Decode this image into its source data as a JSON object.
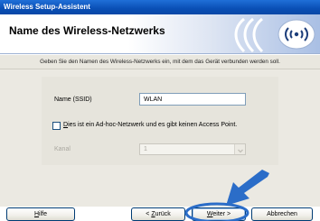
{
  "window": {
    "title": "Wireless Setup-Assistent"
  },
  "header": {
    "title": "Name des Wireless-Netzwerks"
  },
  "instruction": "Geben Sie den Namen des Wireless-Netzwerks ein, mit dem das Gerät verbunden werden soll.",
  "form": {
    "ssid_label": "Name (SSID)",
    "ssid_value": "WLAN",
    "adhoc_checked": false,
    "adhoc_label_underlined": "D",
    "adhoc_label_rest": "ies ist ein Ad-hoc-Netzwerk und es gibt keinen Access Point.",
    "kanal_label": "Kanal",
    "kanal_value": "1",
    "kanal_enabled": false
  },
  "buttons": {
    "help_mnemonic": "H",
    "help_rest": "ilfe",
    "back_prefix": "< ",
    "back_mnemonic": "Z",
    "back_rest": "urück",
    "next_mnemonic": "W",
    "next_rest": "eiter >",
    "cancel": "Abbrechen"
  },
  "colors": {
    "titlebar": "#0a4fb5",
    "pointer_arrow": "#2b6dc8",
    "panel_background": "#ebe9e2"
  },
  "icons": {
    "header_logo": "wireless-signal-icon",
    "pointer": "pointer-arrow-icon"
  }
}
